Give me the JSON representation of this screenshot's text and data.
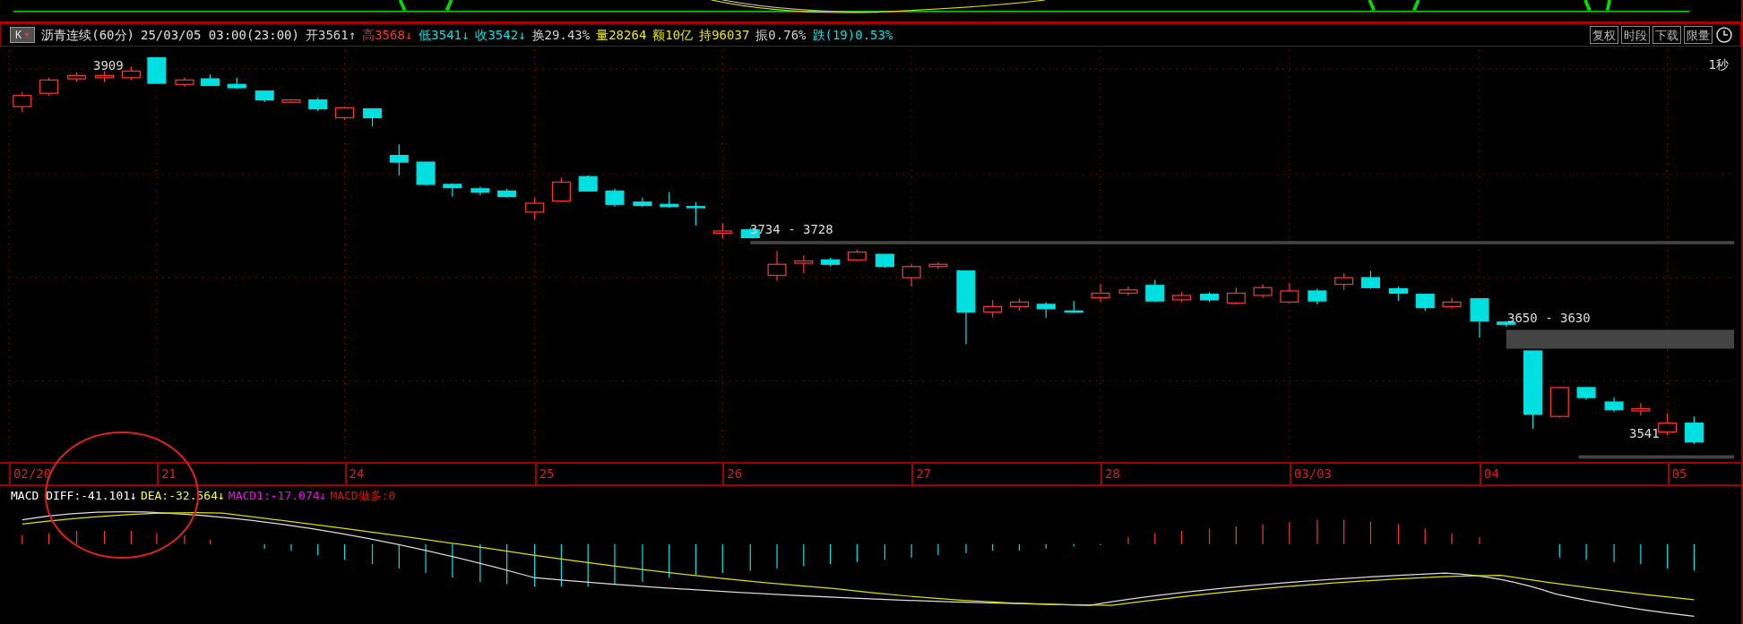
{
  "header": {
    "menu_button": "K",
    "title": "沥青连续(60分)",
    "datetime": "25/03/05 03:00(23:00)",
    "stats": [
      {
        "text": "开3561",
        "arrow": "↑",
        "kind": "neutral"
      },
      {
        "text": "高3568",
        "arrow": "↓",
        "kind": "rise"
      },
      {
        "text": "低3541",
        "arrow": "↓",
        "kind": "fall"
      },
      {
        "text": "收3542",
        "arrow": "↓",
        "kind": "fall"
      },
      {
        "text": "换29.43%",
        "kind": "neutral"
      },
      {
        "text": "量28264",
        "kind": "volume"
      },
      {
        "text": "额10亿",
        "kind": "volume"
      },
      {
        "text": "持96037",
        "kind": "volume"
      },
      {
        "text": "振0.76%",
        "kind": "neutral"
      },
      {
        "text": "跌(19)0.53%",
        "kind": "fall"
      }
    ],
    "buttons": [
      "复权",
      "时段",
      "下载",
      "限量"
    ]
  },
  "refresh_rate": "1秒",
  "price_labels": [
    "3909",
    "3734 - 3728",
    "3650 - 3630",
    "3541"
  ],
  "dates": [
    "02/20",
    "21",
    "24",
    "25",
    "26",
    "27",
    "28",
    "03/03",
    "04",
    "05"
  ],
  "macd_legend": [
    {
      "text": "MACD DIFF:-41.101",
      "arrow": "↓",
      "color": "#ffffff"
    },
    {
      "text": "DEA:-32.564",
      "arrow": "↓",
      "color": "#ffff00"
    },
    {
      "text": "MACD1:-17.074",
      "arrow": "↓",
      "color": "#ff00ff"
    },
    {
      "text": "MACD做多:0",
      "color": "#ff0000"
    }
  ]
}
